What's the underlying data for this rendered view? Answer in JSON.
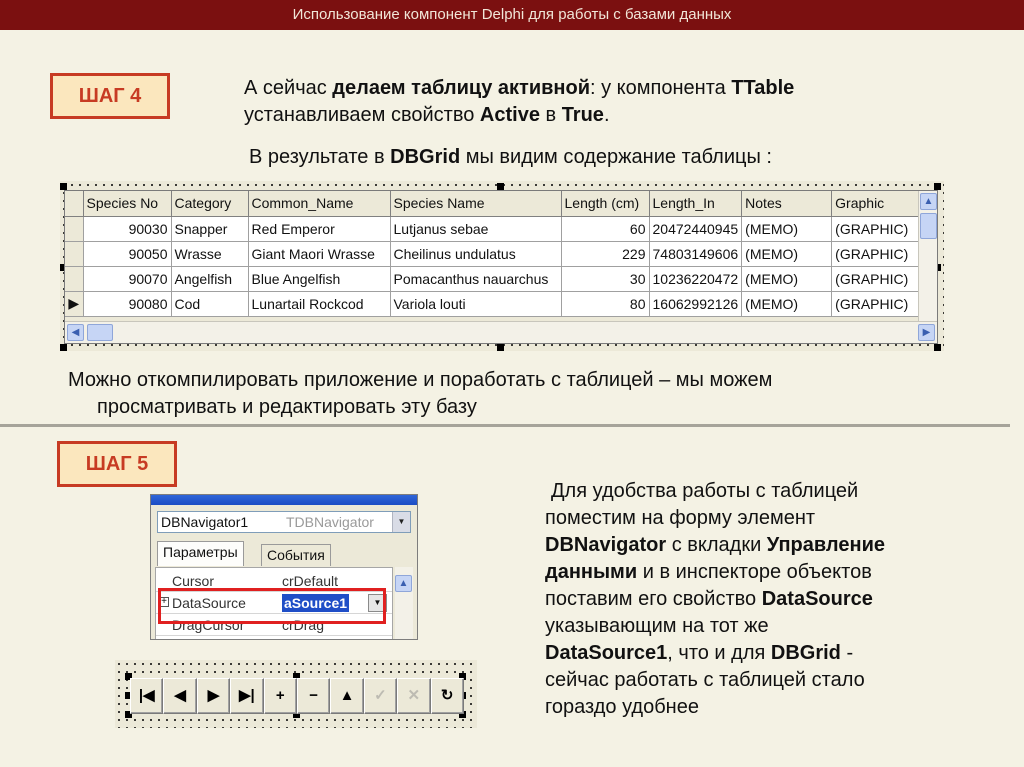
{
  "header": {
    "title": "Использование компонент Delphi для работы с базами данных"
  },
  "step4": {
    "badge": "ШАГ 4",
    "para1": {
      "p1": "А сейчас ",
      "b1": "делаем таблицу активной",
      "p2": ": у компонента ",
      "b2": "TTable",
      "p3": "устанавливаем свойство ",
      "b3": "Active",
      "p4": " в ",
      "b4": "True",
      "p5": "."
    },
    "para2": {
      "p1": "В результате в ",
      "b1": "DBGrid",
      "p2": " мы видим содержание таблицы :"
    },
    "para3": {
      "line1": "Можно откомпилировать приложение и поработать с таблицей – мы можем",
      "line2": "просматривать и редактировать эту базу"
    }
  },
  "grid": {
    "columns": [
      "Species No",
      "Category",
      "Common_Name",
      "Species Name",
      "Length (cm)",
      "Length_In",
      "Notes",
      "Graphic"
    ],
    "rows": [
      [
        "90030",
        "Snapper",
        "Red Emperor",
        "Lutjanus sebae",
        "60",
        "20472440945",
        "(MEMO)",
        "(GRAPHIC)"
      ],
      [
        "90050",
        "Wrasse",
        "Giant Maori Wrasse",
        "Cheilinus undulatus",
        "229",
        "74803149606",
        "(MEMO)",
        "(GRAPHIC)"
      ],
      [
        "90070",
        "Angelfish",
        "Blue Angelfish",
        "Pomacanthus nauarchus",
        "30",
        "10236220472",
        "(MEMO)",
        "(GRAPHIC)"
      ],
      [
        "90080",
        "Cod",
        "Lunartail Rockcod",
        "Variola louti",
        "80",
        "16062992126",
        "(MEMO)",
        "(GRAPHIC)"
      ]
    ],
    "current_row_marker": "▶"
  },
  "step5": {
    "badge": "ШАГ 5",
    "lines": [
      {
        "p": "Для удобства работы с таблицей",
        "b": ""
      },
      {
        "p": "поместим на форму элемент",
        "b": ""
      }
    ],
    "l3": {
      "b1": "DBNavigator",
      "p1": " с вкладки ",
      "b2": "Управление"
    },
    "l4": {
      "b1": "данными",
      "p1": " и в инспекторе объектов"
    },
    "l5": {
      "p1": "поставим его свойство ",
      "b1": "DataSource"
    },
    "l6": "указывающим на тот же",
    "l7": {
      "b1": "DataSource1",
      "p1": ", что и для ",
      "b2": "DBGrid",
      "p2": " -"
    },
    "l8": "сейчас работать с таблицей стало",
    "l9": "гораздо удобнее"
  },
  "inspector": {
    "component": "DBNavigator1",
    "component_type": "TDBNavigator",
    "tabs": [
      "Параметры",
      "События"
    ],
    "props": [
      {
        "name": "Cursor",
        "value": "crDefault"
      },
      {
        "name": "DataSource",
        "value": "aSource1",
        "expand": "+"
      },
      {
        "name": "DragCursor",
        "value": "crDrag"
      }
    ]
  },
  "navigator": {
    "buttons": [
      {
        "name": "first",
        "glyph": "|◀"
      },
      {
        "name": "prior",
        "glyph": "◀"
      },
      {
        "name": "next",
        "glyph": "▶"
      },
      {
        "name": "last",
        "glyph": "▶|"
      },
      {
        "name": "insert",
        "glyph": "+"
      },
      {
        "name": "delete",
        "glyph": "−"
      },
      {
        "name": "edit",
        "glyph": "▲"
      },
      {
        "name": "post",
        "glyph": "✓"
      },
      {
        "name": "cancel",
        "glyph": "✕"
      },
      {
        "name": "refresh",
        "glyph": "↻"
      }
    ]
  },
  "colors": {
    "header_bg": "#7b1010",
    "badge_border": "#c73b23",
    "badge_bg": "#fbe7be",
    "highlight": "#e02020"
  }
}
